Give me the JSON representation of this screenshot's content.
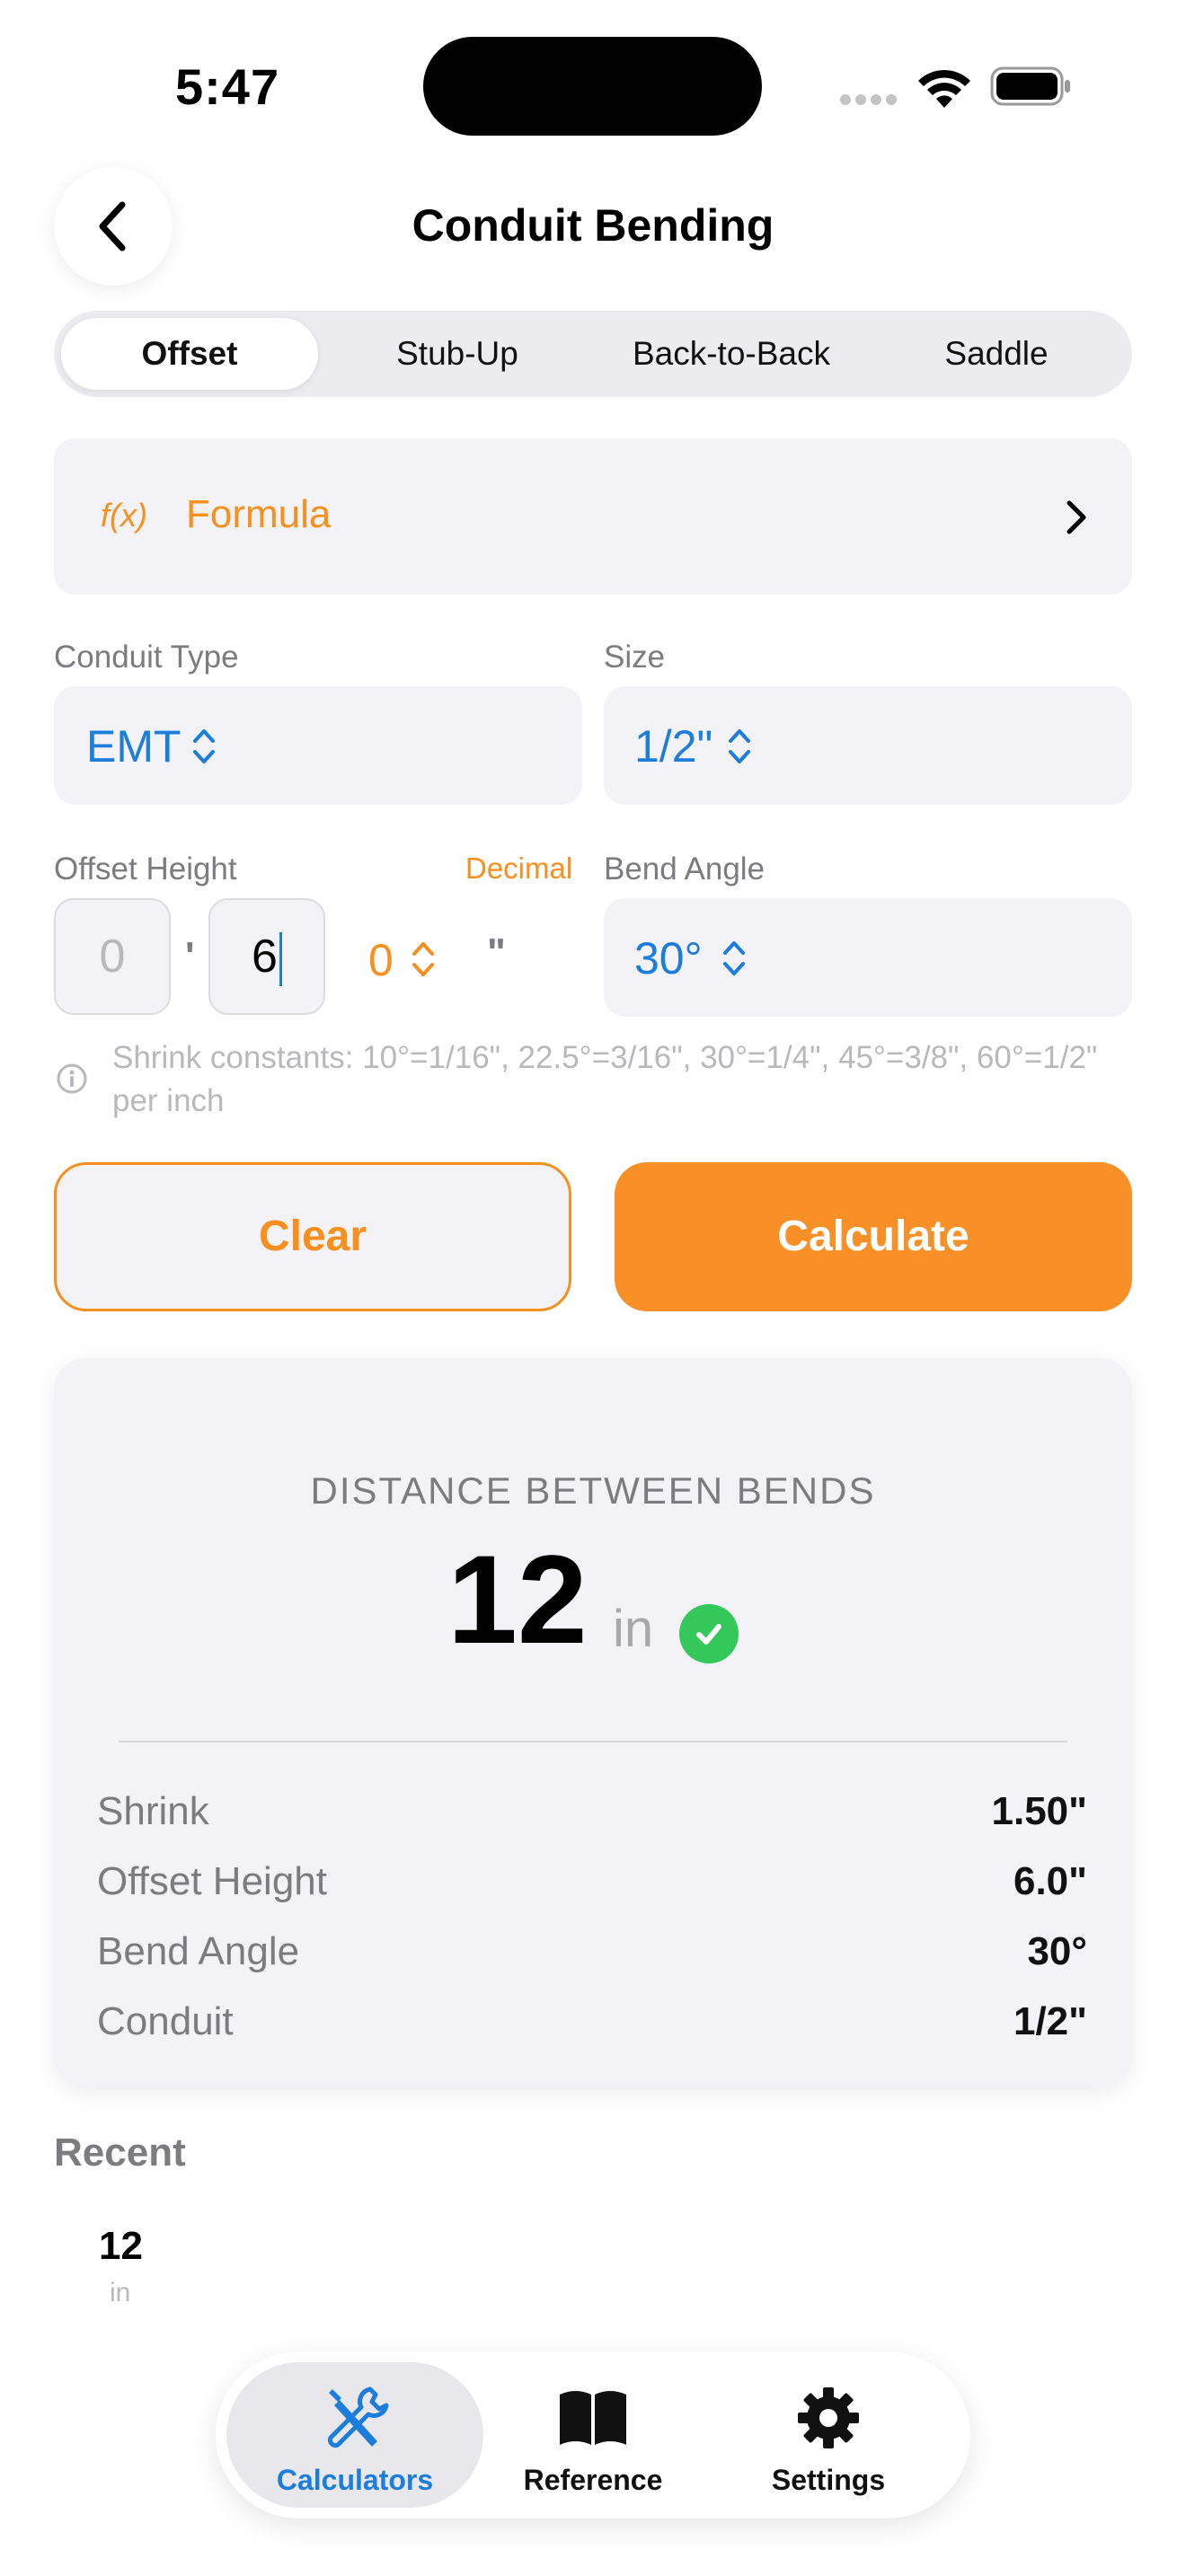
{
  "status": {
    "time": "5:47"
  },
  "header": {
    "title": "Conduit Bending"
  },
  "tabs": [
    {
      "label": "Offset",
      "active": true
    },
    {
      "label": "Stub-Up",
      "active": false
    },
    {
      "label": "Back-to-Back",
      "active": false
    },
    {
      "label": "Saddle",
      "active": false
    }
  ],
  "formula": {
    "icon": "f(x)",
    "label": "Formula"
  },
  "conduit_type": {
    "label": "Conduit Type",
    "value": "EMT"
  },
  "size": {
    "label": "Size",
    "value": "1/2\""
  },
  "offset_height": {
    "label": "Offset Height",
    "mode": "Decimal",
    "feet_placeholder": "0",
    "feet_unit": "'",
    "inches": "6",
    "fraction": "0",
    "inch_unit": "\""
  },
  "bend_angle": {
    "label": "Bend Angle",
    "value": "30°"
  },
  "note": "Shrink constants: 10°=1/16\", 22.5°=3/16\", 30°=1/4\", 45°=3/8\", 60°=1/2\" per inch",
  "buttons": {
    "clear": "Clear",
    "calculate": "Calculate"
  },
  "result": {
    "heading": "DISTANCE BETWEEN BENDS",
    "value": "12",
    "unit": "in",
    "rows": [
      {
        "label": "Shrink",
        "value": "1.50\""
      },
      {
        "label": "Offset Height",
        "value": "6.0\""
      },
      {
        "label": "Bend Angle",
        "value": "30°"
      },
      {
        "label": "Conduit",
        "value": "1/2\""
      }
    ]
  },
  "recent": {
    "title": "Recent",
    "items": [
      {
        "value": "12",
        "unit": "in"
      }
    ]
  },
  "tabbar": [
    {
      "label": "Calculators",
      "icon": "tools-icon",
      "active": true
    },
    {
      "label": "Reference",
      "icon": "book-icon",
      "active": false
    },
    {
      "label": "Settings",
      "icon": "gear-icon",
      "active": false
    }
  ],
  "colors": {
    "accent": "#f7901e",
    "link": "#1c7ddb",
    "success": "#34c759"
  }
}
